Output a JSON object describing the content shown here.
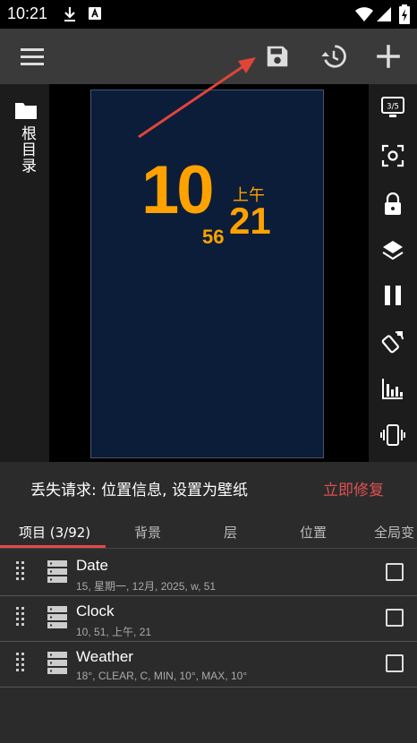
{
  "status_bar": {
    "time": "10:21"
  },
  "toolbar": {
    "menu_icon": "menu-icon",
    "save_icon": "save-icon",
    "history_icon": "history-icon",
    "add_icon": "plus-icon"
  },
  "preview": {
    "folder_label": "根目录",
    "clock": {
      "hour": "10",
      "minute": "21",
      "second": "56",
      "ampm": "上午"
    },
    "right_tools": [
      "screen-3-5-icon",
      "screenshot-icon",
      "lock-icon",
      "layers-icon",
      "pause-icon",
      "rotate-icon",
      "chart-icon",
      "vibrate-icon"
    ],
    "screen_badge": "3/5"
  },
  "warning": {
    "text": "丢失请求: 位置信息, 设置为壁纸",
    "fix_label": "立即修复"
  },
  "tabs": [
    {
      "label": "项目 (3/92)"
    },
    {
      "label": "背景"
    },
    {
      "label": "层"
    },
    {
      "label": "位置"
    },
    {
      "label": "全局变"
    }
  ],
  "items": [
    {
      "title": "Date",
      "subtitle": "15, 星期一, 12月, 2025, w, 51"
    },
    {
      "title": "Clock",
      "subtitle": "10, 51, 上午, 21"
    },
    {
      "title": "Weather",
      "subtitle": "18°, CLEAR, C, MIN, 10°, MAX, 10°"
    }
  ],
  "colors": {
    "accent": "#ffa200",
    "warning": "#e05050",
    "canvas_bg": "#0c1d3a",
    "arrow": "#e0453a"
  }
}
